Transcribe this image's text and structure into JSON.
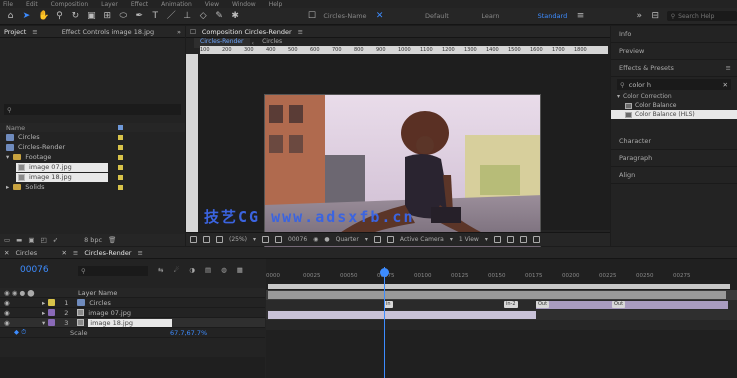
{
  "menu": {
    "items": [
      "File",
      "Edit",
      "Composition",
      "Layer",
      "Effect",
      "Animation",
      "View",
      "Window",
      "Help"
    ]
  },
  "toolbar": {
    "layer_name_placeholder": "Circles-Name",
    "workspaces": [
      "Default",
      "Learn",
      "Standard"
    ],
    "active_workspace": "Standard",
    "search_placeholder": "Search Help"
  },
  "project": {
    "tab": "Project",
    "effect_controls_tab": "Effect Controls image 18.jpg",
    "search_placeholder": "",
    "columns": [
      "Name"
    ],
    "items": [
      {
        "name": "Circles",
        "type": "comp"
      },
      {
        "name": "Circles-Render",
        "type": "comp"
      },
      {
        "name": "Footage",
        "type": "folder"
      },
      {
        "name": "image 07.jpg",
        "type": "image",
        "selected": true
      },
      {
        "name": "image 18.jpg",
        "type": "image",
        "selected": true
      },
      {
        "name": "Solids",
        "type": "folder"
      }
    ],
    "bpc": "8 bpc"
  },
  "composition": {
    "tab": "Composition Circles-Render",
    "subtabs": [
      "Circles-Render",
      "Circles"
    ],
    "active_subtab": "Circles-Render",
    "ruler_numbers": [
      "100",
      "200",
      "300",
      "400",
      "500",
      "600",
      "700",
      "800",
      "900",
      "1000",
      "1100",
      "1200",
      "1300",
      "1400",
      "1500",
      "1600",
      "1700",
      "1800"
    ],
    "watermark": "技艺CG www.adsxfb.cn",
    "footer": {
      "zoom": "(25%)",
      "timecode": "00076",
      "quality": "Quarter",
      "camera": "Active Camera",
      "views": "1 View"
    }
  },
  "right_panel": {
    "sections": [
      "Info",
      "Preview"
    ],
    "effects_title": "Effects & Presets",
    "effects_search": "color h",
    "category": "Color Correction",
    "effects": [
      "Color Balance",
      "Color Balance (HLS)"
    ],
    "selected_effect": "Color Balance (HLS)",
    "lower_sections": [
      "Character",
      "Paragraph",
      "Align"
    ]
  },
  "timeline": {
    "tabs": [
      "Circles",
      "Circles-Render"
    ],
    "active_tab": "Circles-Render",
    "timecode": "00076",
    "search_placeholder": "",
    "column_header": "Layer Name",
    "layers": [
      {
        "num": "1",
        "name": "Circles",
        "selected": false
      },
      {
        "num": "2",
        "name": "image 07.jpg",
        "selected": false
      },
      {
        "num": "3",
        "name": "image 18.jpg",
        "selected": true
      }
    ],
    "sub_property": "Scale",
    "sub_value": "67.7,67.7%",
    "ruler_labels": [
      "0000",
      "00025",
      "00050",
      "00075",
      "00100",
      "00125",
      "00150",
      "00175",
      "00200",
      "00225",
      "00250",
      "00275",
      "00300",
      "00325",
      "00350"
    ],
    "markers": [
      "in",
      "in-2",
      "Out",
      "Out"
    ],
    "playhead_frame": 76
  },
  "colors": {
    "accent": "#3d8cff",
    "panel": "#232323",
    "label_yellow": "#d8c34a"
  }
}
